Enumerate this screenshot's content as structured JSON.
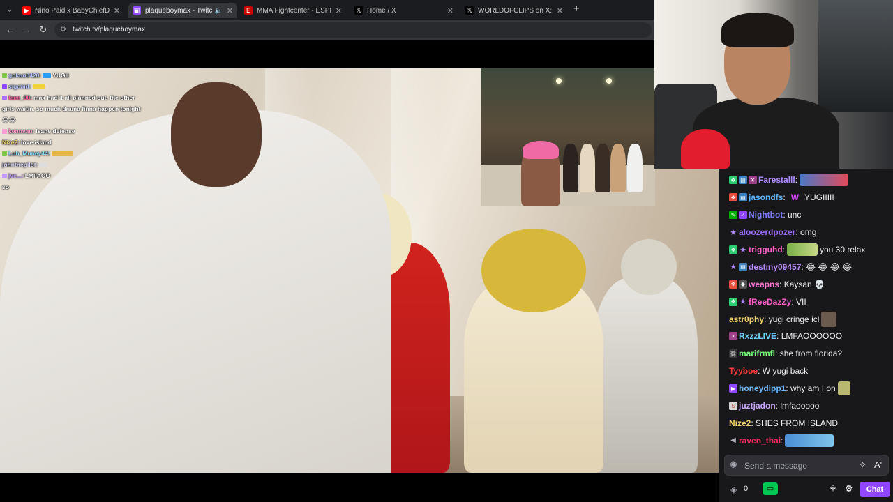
{
  "browser": {
    "tabs": [
      {
        "label": "Nino Paid x BabyChiefDoit x Pla",
        "fav_color": "#ff0000",
        "fav_glyph": "▶"
      },
      {
        "label": "plaqueboymax - Twitch",
        "fav_color": "#9147ff",
        "fav_glyph": "▣"
      },
      {
        "label": "MMA Fightcenter - ESPN",
        "fav_color": "#d00000",
        "fav_glyph": "E"
      },
      {
        "label": "Home / X",
        "fav_color": "#000000",
        "fav_glyph": "𝕏"
      },
      {
        "label": "WORLDOFCLIPS on X: \"Mrbeas",
        "fav_color": "#000000",
        "fav_glyph": "𝕏"
      }
    ],
    "url": "twitch.tv/plaqueboymax"
  },
  "video_chat": [
    {
      "user": "gokuu0420:",
      "text": "YUGII",
      "color": "#b6c8ff"
    },
    {
      "user": "sigchid:",
      "text": "",
      "color": "#b6c8ff"
    },
    {
      "user": "faee_00:",
      "text": "max had it all planned out. the other",
      "color": "#ff5fa2"
    },
    {
      "user": "",
      "text": "girls waitin. so much drama finna happen tonight",
      "color": "#ffffff"
    },
    {
      "user": "",
      "text": "😂😂",
      "color": "#ffffff"
    },
    {
      "user": "kennvan:",
      "text": "isane defense",
      "color": "#ff9ad5"
    },
    {
      "user": "Nize2:",
      "text": "love island",
      "color": "#f5d76e"
    },
    {
      "user": "Luh_Muney44:",
      "text": "",
      "color": "#8be0ff"
    },
    {
      "user": "johnthepilot:",
      "text": "",
      "color": "#d7d7ff"
    },
    {
      "user": "jvc...:",
      "text": "LMFAOO",
      "color": "#c39bff"
    },
    {
      "user": "",
      "text": "so",
      "color": "#ffffff"
    }
  ],
  "chat": {
    "messages": [
      {
        "user": "Farestalll",
        "text": "",
        "color": "#b18cff",
        "emote": "wide"
      },
      {
        "user": "jasondfs",
        "text": "YUGIIIII",
        "color": "#5fb8ff",
        "prefix": "W"
      },
      {
        "user": "Nightbot",
        "text": "unc",
        "color": "#7c7cff"
      },
      {
        "user": "aloozerdpozer",
        "text": "omg",
        "color": "#9b6bff"
      },
      {
        "user": "trigguhd",
        "text": "you 30 relax",
        "color": "#ff5ec8",
        "emote": "med"
      },
      {
        "user": "destiny09457",
        "text": "😂 😂 😂 😂",
        "color": "#b98cff"
      },
      {
        "user": "weapns",
        "text": "Kaysan 💀",
        "color": "#ff7ad8"
      },
      {
        "user": "fReeDazZy",
        "text": "VII",
        "color": "#ff5ec8"
      },
      {
        "user": "astr0phy",
        "text": "yugi cringe icl",
        "color": "#f5d76e",
        "emote": "single"
      },
      {
        "user": "RxzzLIVE",
        "text": "LMFAOOOOOO",
        "color": "#6bd6ff"
      },
      {
        "user": "marifrmfl",
        "text": "she from florida?",
        "color": "#7cff7c"
      },
      {
        "user": "Tyyboe",
        "text": "W yugi back",
        "color": "#ff3b3b"
      },
      {
        "user": "honeydipp1",
        "text": "why am I on",
        "color": "#6bb8ff",
        "emote": "single"
      },
      {
        "user": "juztjadon",
        "text": "lmfaooooo",
        "color": "#c9a7ff"
      },
      {
        "user": "Nize2",
        "text": "SHES FROM ISLAND",
        "color": "#f5d76e"
      },
      {
        "user": "raven_thai",
        "text": "",
        "color": "#ff2e63",
        "emote": "wide"
      }
    ],
    "input_placeholder": "Send a message",
    "points": "0",
    "chat_button": "Chat"
  },
  "colors": {
    "twitch_purple": "#9147ff",
    "chat_bg": "#18181b",
    "bonus_green": "#00c853"
  }
}
